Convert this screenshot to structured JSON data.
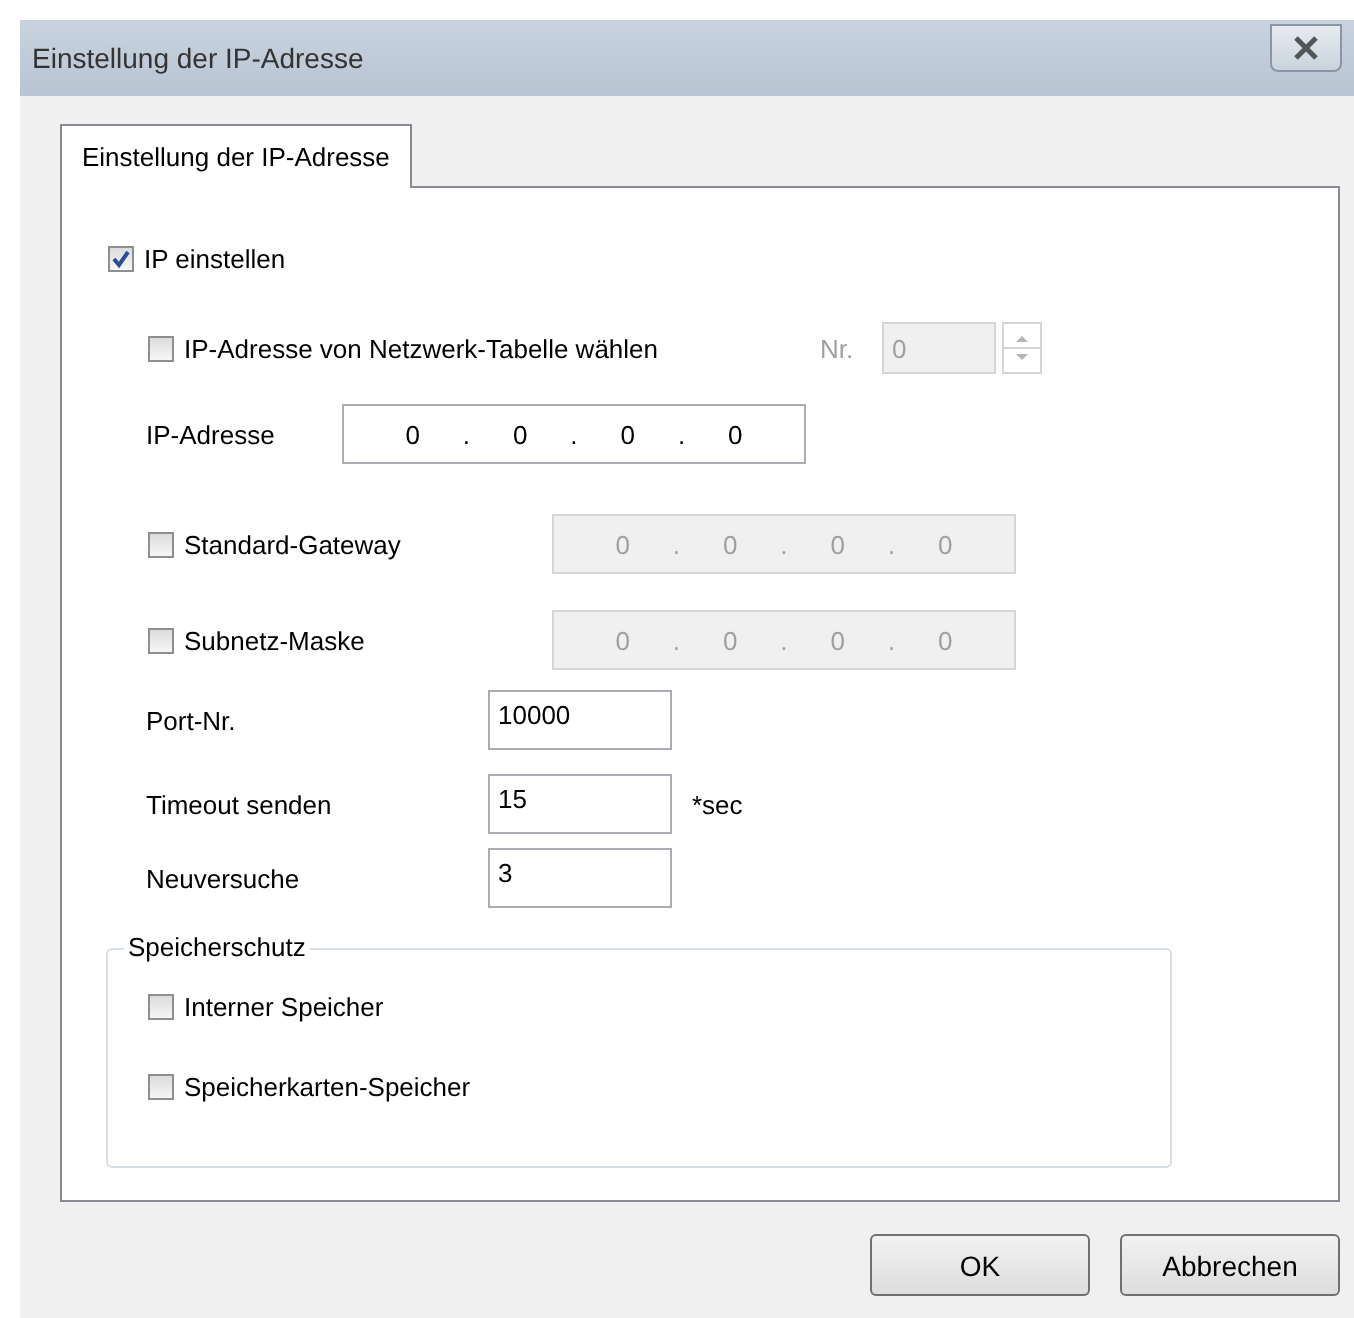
{
  "window": {
    "title": "Einstellung der IP-Adresse"
  },
  "tabs": [
    {
      "label": "Einstellung der IP-Adresse",
      "selected": true
    }
  ],
  "ip_enable": {
    "label": "IP einstellen",
    "checked": true
  },
  "network_table": {
    "label": "IP-Adresse von Netzwerk-Tabelle wählen",
    "checked": false,
    "nr_label": "Nr.",
    "nr_value": "0",
    "disabled": true
  },
  "ip_address": {
    "label": "IP-Adresse",
    "octets": [
      "0",
      "0",
      "0",
      "0"
    ],
    "separator": ".",
    "disabled": false
  },
  "gateway": {
    "label": "Standard-Gateway",
    "checked": false,
    "octets": [
      "0",
      "0",
      "0",
      "0"
    ],
    "separator": ".",
    "disabled": true
  },
  "subnet": {
    "label": "Subnetz-Maske",
    "checked": false,
    "octets": [
      "0",
      "0",
      "0",
      "0"
    ],
    "separator": ".",
    "disabled": true
  },
  "port": {
    "label": "Port-Nr.",
    "value": "10000"
  },
  "timeout": {
    "label": "Timeout senden",
    "value": "15",
    "unit": "*sec"
  },
  "retries": {
    "label": "Neuversuche",
    "value": "3"
  },
  "memory_protection": {
    "title": "Speicherschutz",
    "items": [
      {
        "label": "Interner Speicher",
        "checked": false
      },
      {
        "label": "Speicherkarten-Speicher",
        "checked": false
      }
    ]
  },
  "buttons": [
    {
      "label": "OK"
    },
    {
      "label": "Abbrechen"
    }
  ]
}
